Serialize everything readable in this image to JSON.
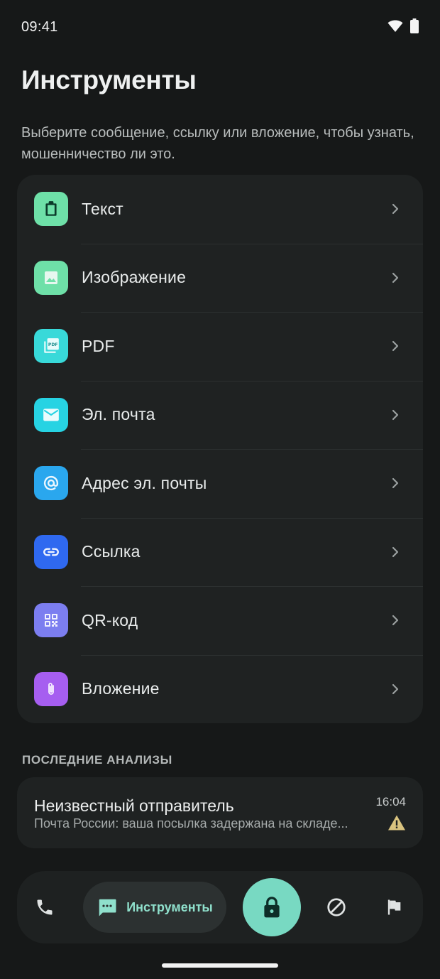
{
  "status_bar": {
    "time": "09:41"
  },
  "header": {
    "title": "Инструменты",
    "subtitle": "Выберите сообщение, ссылку или вложение, чтобы узнать, мошенничество ли это."
  },
  "tools": [
    {
      "label": "Текст",
      "icon": "clipboard-icon",
      "color": "#6ee0a8"
    },
    {
      "label": "Изображение",
      "icon": "image-icon",
      "color": "#6ee0a8"
    },
    {
      "label": "PDF",
      "icon": "pdf-icon",
      "color": "#38d9d9"
    },
    {
      "label": "Эл. почта",
      "icon": "mail-icon",
      "color": "#27d3e3"
    },
    {
      "label": "Адрес эл. почты",
      "icon": "at-icon",
      "color": "#2aa7ee"
    },
    {
      "label": "Ссылка",
      "icon": "link-icon",
      "color": "#2f69f0"
    },
    {
      "label": "QR-код",
      "icon": "qr-code-icon",
      "color": "#7c7ef0"
    },
    {
      "label": "Вложение",
      "icon": "paperclip-icon",
      "color": "#a65ef0"
    }
  ],
  "recent": {
    "section_title": "ПОСЛЕДНИЕ АНАЛИЗЫ",
    "items": [
      {
        "title": "Неизвестный отправитель",
        "snippet": "Почта России: ваша посылка задержана на складе...",
        "time": "16:04",
        "status_icon": "warning-icon",
        "status_color": "#d9c37f"
      }
    ]
  },
  "bottom_nav": {
    "tools_label": "Инструменты",
    "accent": "#78d9c2",
    "items": [
      "phone-icon",
      "message-icon",
      "lock-icon",
      "block-icon",
      "flag-icon"
    ]
  }
}
